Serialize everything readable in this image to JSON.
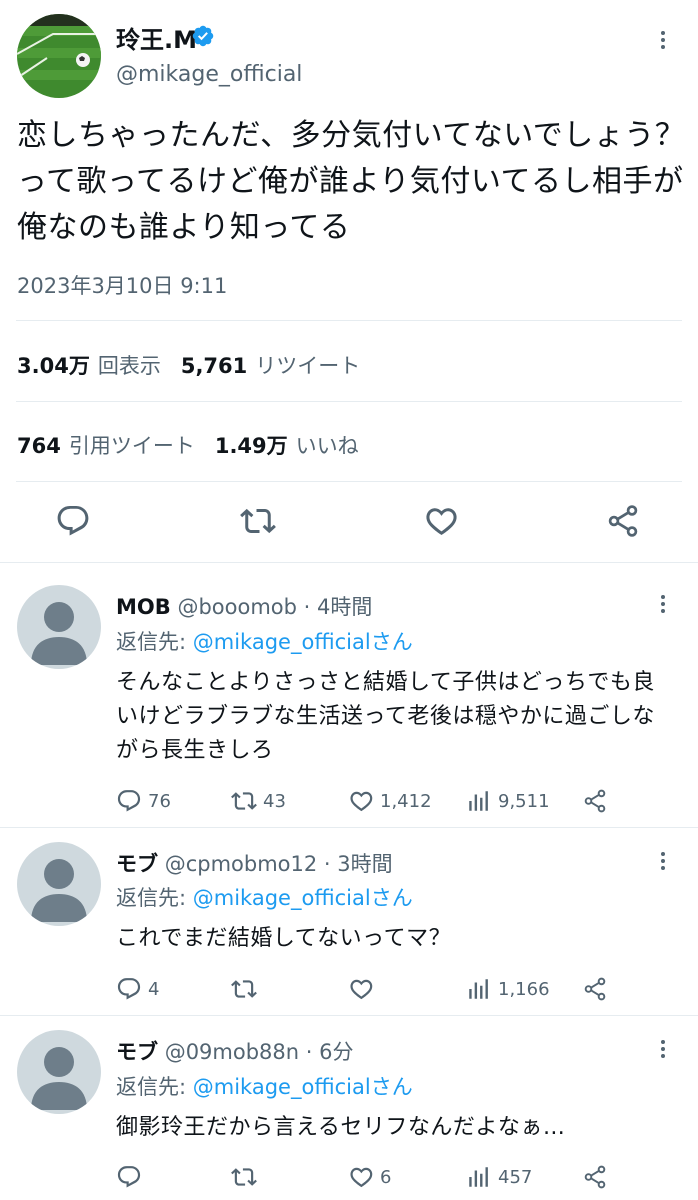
{
  "tweet": {
    "author_name": "玲王.M",
    "author_handle": "@mikage_official",
    "text": "恋しちゃったんだ、多分気付いてないでしょう？って歌ってるけど俺が誰より気付いてるし相手が俺なのも誰より知ってる",
    "timestamp": "2023年3月10日 9:11",
    "views_count": "3.04万",
    "views_label": "回表示",
    "retweets_count": "5,761",
    "retweets_label": "リツイート",
    "quotes_count": "764",
    "quotes_label": "引用ツイート",
    "likes_count": "1.49万",
    "likes_label": "いいね"
  },
  "replies": [
    {
      "name": "MOB",
      "handle": "@booomob",
      "time": "· 4時間",
      "reply_to_prefix": "返信先: ",
      "reply_to": "@mikage_officialさん",
      "text": "そんなことよりさっさと結婚して子供はどっちでも良いけどラブラブな生活送って老後は穏やかに過ごしながら長生きしろ",
      "replies": "76",
      "retweets": "43",
      "likes": "1,412",
      "views": "9,511"
    },
    {
      "name": "モブ",
      "handle": "@cpmobmo12",
      "time": "· 3時間",
      "reply_to_prefix": "返信先: ",
      "reply_to": "@mikage_officialさん",
      "text": "これでまだ結婚してないってマ？",
      "replies": "4",
      "retweets": "",
      "likes": "",
      "views": "1,166"
    },
    {
      "name": "モブ",
      "handle": "@09mob88n",
      "time": "· 6分",
      "reply_to_prefix": "返信先: ",
      "reply_to": "@mikage_officialさん",
      "text": "御影玲王だから言えるセリフなんだよなぁ…",
      "replies": "",
      "retweets": "",
      "likes": "6",
      "views": "457"
    }
  ],
  "icons": {
    "more": "more-vertical-icon",
    "verified": "verified-badge-icon",
    "reply": "reply-icon",
    "retweet": "retweet-icon",
    "like": "heart-icon",
    "views": "views-chart-icon",
    "share": "share-icon"
  },
  "colors": {
    "accent": "#1d9bf0",
    "text": "#0f1419",
    "secondary": "#536471",
    "divider": "#e6ecf0",
    "avatar_placeholder": "#cfd9de",
    "avatar_figure": "#6e7e8a"
  }
}
